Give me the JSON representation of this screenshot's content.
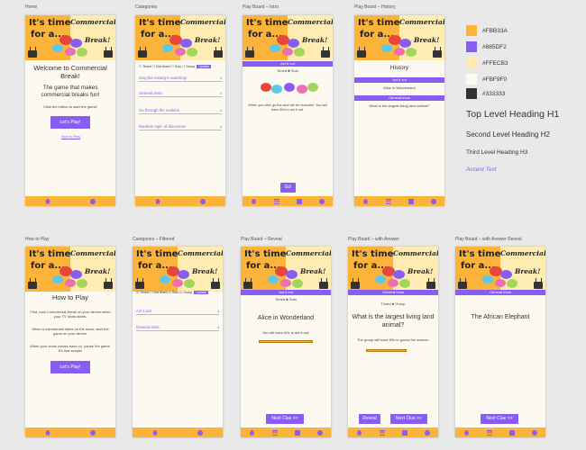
{
  "banner": {
    "line1": "It's time",
    "line2": "for a...",
    "word1": "Commercial",
    "word2": "Break!"
  },
  "frames": {
    "home": {
      "label": "Home",
      "title": "Welcome to Commercial Break!",
      "subtitle": "The game that makes commercial breaks fun!",
      "instruction": "Click the button to start the game!",
      "button": "Let's Play!",
      "link": "How to Play"
    },
    "categories": {
      "label": "Categories",
      "filters": "☐ Timed ☐ Not timed ☐ Solo ☐ Group",
      "filter_button": "Update",
      "items": [
        {
          "label": "Sing the melody's watching!",
          "count": "4"
        },
        {
          "label": "General trivia",
          "count": "4"
        },
        {
          "label": "Go through the motions",
          "count": "4"
        },
        {
          "label": "Random topic of discussion",
          "count": "4"
        }
      ]
    },
    "intro": {
      "label": "Play Board – Intro",
      "category": "Act it out",
      "meta": "Timed ♣ Solo",
      "instruction": "When you click go the clue will be revealed. You will have 60s to act it out.",
      "button": "Go!"
    },
    "history": {
      "label": "Play Board – History",
      "title": "History",
      "cat1": "Act it out",
      "clue1": "Alice in Wonderland",
      "cat2": "General trivia",
      "clue2": "What is the largest living land animal?"
    },
    "howto": {
      "label": "How to Play",
      "title": "How to Play",
      "p1": "First, load Commercial Break on your device when your TV show starts.",
      "p2": "When a commercial starts on the show, start the game on your device.",
      "p3": "When your show comes back on, pause the game. It's that simple!",
      "button": "Let's Play!"
    },
    "categories_filtered": {
      "label": "Categories – Filtered",
      "filters": "☑ Timed ☐ Not timed ☑ Solo ☑ Group",
      "filter_button": "Update",
      "items": [
        {
          "label": "Act it out",
          "count": "4"
        },
        {
          "label": "General trivia",
          "count": "4"
        }
      ]
    },
    "reveal": {
      "label": "Play Board – Reveal",
      "category": "Act it out",
      "meta": "Timed ♣ Solo",
      "clue": "Alice in Wonderland",
      "timer": "You will have 60s to act it out.",
      "progress": 1.0,
      "button": "Next Clue >>"
    },
    "with_answer": {
      "label": "Play Board – with Answer",
      "category": "General trivia",
      "meta": "Timed ♣ Group",
      "clue": "What is the largest living land animal?",
      "timer": "The group will have 60s to guess the answer.",
      "progress": 0.75,
      "reveal_button": "Reveal",
      "next_button": "Next Clue >>"
    },
    "answer_reveal": {
      "label": "Play Board – with Answer Reveal",
      "category": "General trivia",
      "answer": "The African Elephant",
      "button": "Next Clue >>"
    }
  },
  "style_guide": {
    "colors": [
      {
        "hex": "#FBB33A",
        "label": "#FBB33A"
      },
      {
        "hex": "#885DF2",
        "label": "#885DF2"
      },
      {
        "hex": "#FFECB3",
        "label": "#FFECB3"
      },
      {
        "hex": "#FBF9F0",
        "label": "#FBF9F0"
      },
      {
        "hex": "#333333",
        "label": "#333333"
      }
    ],
    "h1": "Top Level Heading H1",
    "h2": "Second Level Heading H2",
    "h3": "Third Level Heading H3",
    "accent": "Accent Text"
  }
}
